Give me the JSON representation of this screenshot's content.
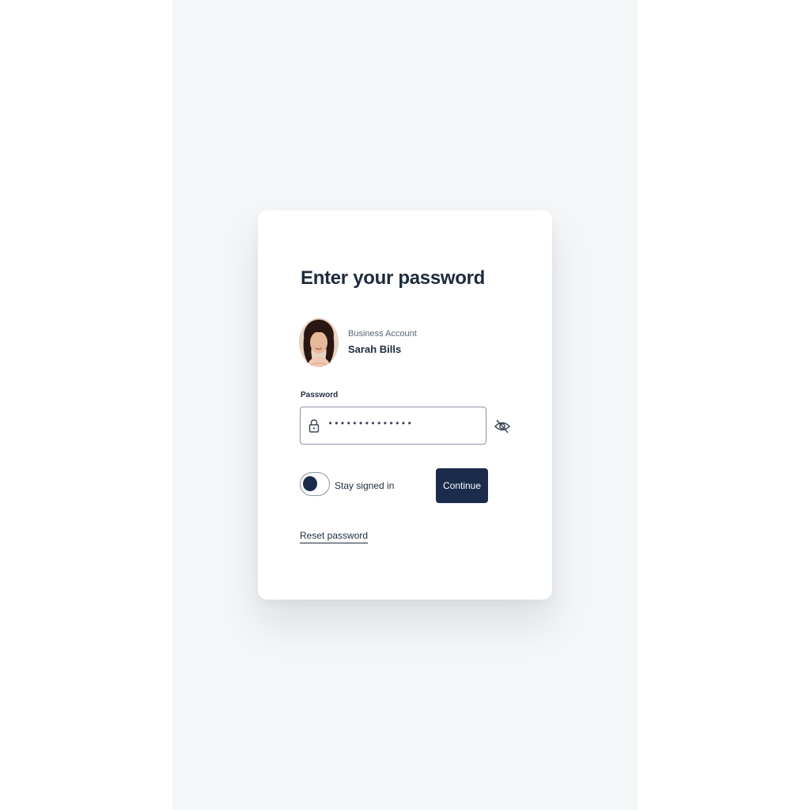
{
  "page": {
    "title": "Enter your password"
  },
  "account": {
    "type_label": "Business Account",
    "name": "Sarah Bills",
    "avatar_icon": "user-avatar-photo"
  },
  "password": {
    "label": "Password",
    "masked_value": "••••••••••••••",
    "lock_icon": "lock-icon",
    "visibility_icon": "eye-off-icon"
  },
  "stay_signed_in": {
    "label": "Stay signed in",
    "enabled": false
  },
  "actions": {
    "continue_label": "Continue",
    "reset_label": "Reset password"
  },
  "colors": {
    "background": "#f4f6f8",
    "card": "#ffffff",
    "primary": "#1a2b4c",
    "text": "#1e2b3d",
    "border": "#8a94a3"
  }
}
